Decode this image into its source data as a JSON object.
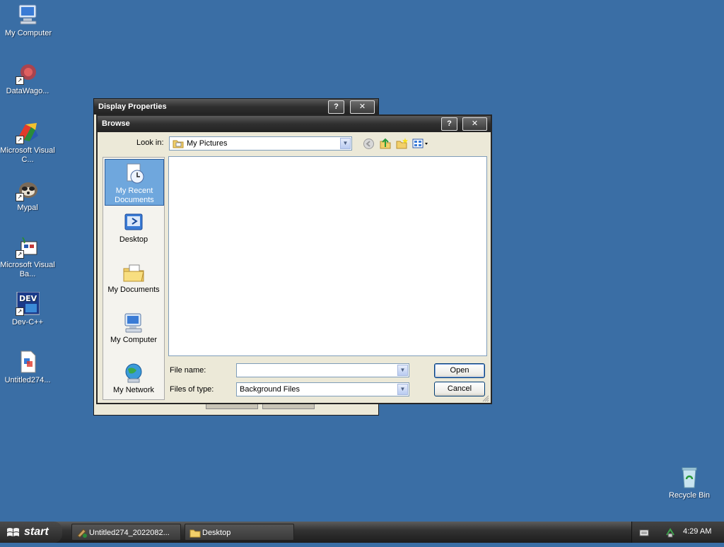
{
  "desktop": {
    "icons": [
      {
        "label": "My Computer",
        "icon": "my-computer-icon"
      },
      {
        "label": "DataWago...",
        "icon": "datawagon-icon"
      },
      {
        "label": "Microsoft Visual C...",
        "icon": "visual-c-icon"
      },
      {
        "label": "Mypal",
        "icon": "mypal-icon"
      },
      {
        "label": "Microsoft Visual Ba...",
        "icon": "visual-basic-icon"
      },
      {
        "label": "Dev-C++",
        "icon": "dev-cpp-icon"
      },
      {
        "label": "Untitled274...",
        "icon": "image-file-icon"
      },
      {
        "label": "Recycle Bin",
        "icon": "recycle-bin-icon"
      }
    ]
  },
  "display_properties": {
    "title": "Display Properties",
    "help_btn": "?",
    "close_btn": "✕"
  },
  "browse": {
    "title": "Browse",
    "help_btn": "?",
    "close_btn": "✕",
    "look_in_label": "Look in:",
    "look_in_value": "My Pictures",
    "places": [
      {
        "label": "My Recent Documents",
        "icon": "recent-documents-icon",
        "selected": true
      },
      {
        "label": "Desktop",
        "icon": "desktop-icon"
      },
      {
        "label": "My Documents",
        "icon": "my-documents-icon"
      },
      {
        "label": "My Computer",
        "icon": "my-computer-icon"
      },
      {
        "label": "My Network",
        "icon": "my-network-icon"
      }
    ],
    "file_name_label": "File name:",
    "file_name_value": "",
    "files_of_type_label": "Files of type:",
    "files_of_type_value": "Background Files",
    "open_label": "Open",
    "cancel_label": "Cancel"
  },
  "taskbar": {
    "start_label": "start",
    "tasks": [
      {
        "label": "Untitled274_2022082...",
        "icon": "paint-icon"
      },
      {
        "label": "Desktop",
        "icon": "folder-icon"
      }
    ],
    "clock": "4:29 AM"
  },
  "colors": {
    "desktop_bg": "#3a6ea5",
    "selected_place": "#6fa7dd"
  }
}
